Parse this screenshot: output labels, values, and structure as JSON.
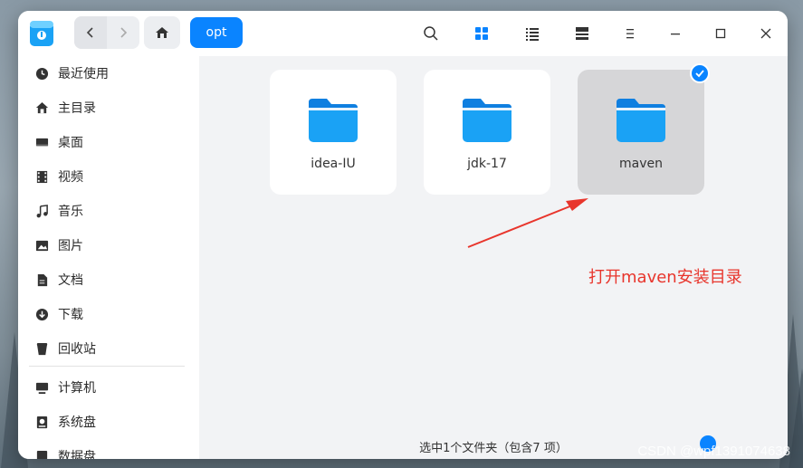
{
  "toolbar": {
    "crumb": "opt",
    "icons": [
      "search-icon",
      "icon-view-icon",
      "list-view-icon",
      "details-toggle-icon",
      "menu-icon",
      "minimize-icon",
      "maximize-icon",
      "close-icon"
    ]
  },
  "sidebar": {
    "items": [
      {
        "label": "最近使用",
        "icon": "clock-icon"
      },
      {
        "label": "主目录",
        "icon": "home-icon"
      },
      {
        "label": "桌面",
        "icon": "desktop-icon"
      },
      {
        "label": "视频",
        "icon": "video-icon"
      },
      {
        "label": "音乐",
        "icon": "music-icon"
      },
      {
        "label": "图片",
        "icon": "picture-icon"
      },
      {
        "label": "文档",
        "icon": "document-icon"
      },
      {
        "label": "下载",
        "icon": "download-icon"
      },
      {
        "label": "回收站",
        "icon": "trash-icon"
      },
      {
        "label": "计算机",
        "icon": "computer-icon"
      },
      {
        "label": "系统盘",
        "icon": "disk-icon"
      },
      {
        "label": "数据盘",
        "icon": "disk-icon"
      }
    ]
  },
  "files": [
    {
      "name": "idea-IU",
      "selected": false
    },
    {
      "name": "jdk-17",
      "selected": false
    },
    {
      "name": "maven",
      "selected": true
    }
  ],
  "annotation": "打开maven安装目录",
  "status": "选中1个文件夹（包含7 项）",
  "watermark": "CSDN @wpf1391074638",
  "colors": {
    "accent": "#0a84ff",
    "annotation": "#e8352c",
    "folder": "#1aa2f5"
  }
}
